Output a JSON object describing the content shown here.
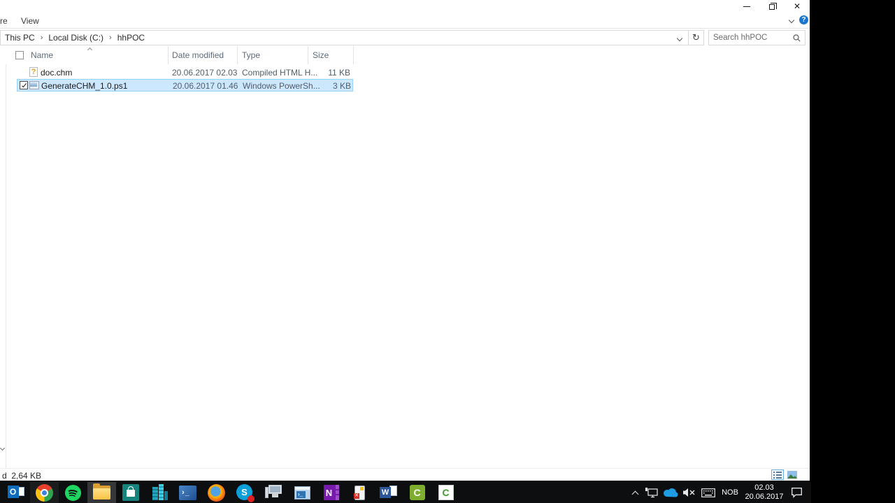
{
  "glyphs": {
    "close": "✕",
    "help": "?",
    "refresh": "↻",
    "breadcrumb_separator": "›",
    "outlook": "O",
    "powershell": "›_",
    "powershell_ise": "›_",
    "onenote": "N",
    "word": "W",
    "skype": "S",
    "camtasia": "C",
    "alert_x": "✕"
  },
  "ribbon": {
    "tab_share_partial": "re",
    "tab_view": "View"
  },
  "address_bar": {
    "breadcrumb": [
      "This PC",
      "Local Disk (C:)",
      "hhPOC"
    ]
  },
  "search": {
    "placeholder": "Search hhPOC"
  },
  "file_list": {
    "columns": {
      "name": "Name",
      "date_modified": "Date modified",
      "type": "Type",
      "size": "Size"
    },
    "rows": [
      {
        "name": "doc.chm",
        "date": "20.06.2017 02.03",
        "type": "Compiled HTML H...",
        "size": "11 KB",
        "icon": "chm-help-file",
        "selected": false
      },
      {
        "name": "GenerateCHM_1.0.ps1",
        "date": "20.06.2017 01.46",
        "type": "Windows PowerSh...",
        "size": "3 KB",
        "icon": "powershell-script",
        "selected": true,
        "checked": true
      }
    ]
  },
  "status_bar": {
    "summary": "d  2,64 KB"
  },
  "taskbar": {
    "icons": [
      "outlook",
      "chrome",
      "spotify",
      "file-explorer",
      "windows-store",
      "server-manager",
      "powershell",
      "firefox",
      "skype",
      "remote-desktop",
      "powershell-ise",
      "onenote",
      "device-alert",
      "word",
      "camtasia",
      "camtasia-recorder"
    ],
    "tray": {
      "language": "NOB",
      "time": "02.03",
      "date": "20.06.2017"
    }
  },
  "colors": {
    "selection_fill": "#cce8ff",
    "selection_border": "#99d1ff",
    "accent_blue": "#0078d7",
    "taskbar_bg": "#0c0e10"
  }
}
